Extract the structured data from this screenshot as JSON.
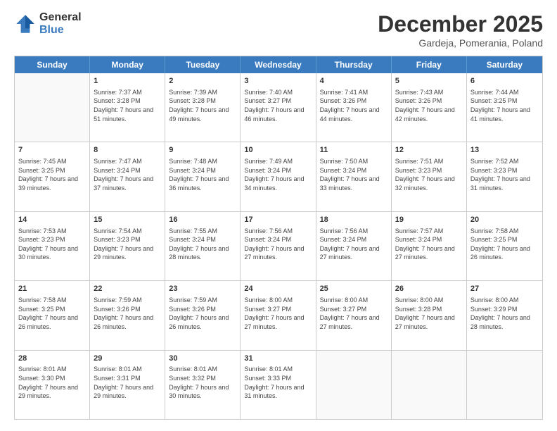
{
  "logo": {
    "general": "General",
    "blue": "Blue"
  },
  "title": "December 2025",
  "subtitle": "Gardeja, Pomerania, Poland",
  "days": [
    "Sunday",
    "Monday",
    "Tuesday",
    "Wednesday",
    "Thursday",
    "Friday",
    "Saturday"
  ],
  "weeks": [
    [
      {
        "num": "",
        "sunrise": "",
        "sunset": "",
        "daylight": ""
      },
      {
        "num": "1",
        "sunrise": "Sunrise: 7:37 AM",
        "sunset": "Sunset: 3:28 PM",
        "daylight": "Daylight: 7 hours and 51 minutes."
      },
      {
        "num": "2",
        "sunrise": "Sunrise: 7:39 AM",
        "sunset": "Sunset: 3:28 PM",
        "daylight": "Daylight: 7 hours and 49 minutes."
      },
      {
        "num": "3",
        "sunrise": "Sunrise: 7:40 AM",
        "sunset": "Sunset: 3:27 PM",
        "daylight": "Daylight: 7 hours and 46 minutes."
      },
      {
        "num": "4",
        "sunrise": "Sunrise: 7:41 AM",
        "sunset": "Sunset: 3:26 PM",
        "daylight": "Daylight: 7 hours and 44 minutes."
      },
      {
        "num": "5",
        "sunrise": "Sunrise: 7:43 AM",
        "sunset": "Sunset: 3:26 PM",
        "daylight": "Daylight: 7 hours and 42 minutes."
      },
      {
        "num": "6",
        "sunrise": "Sunrise: 7:44 AM",
        "sunset": "Sunset: 3:25 PM",
        "daylight": "Daylight: 7 hours and 41 minutes."
      }
    ],
    [
      {
        "num": "7",
        "sunrise": "Sunrise: 7:45 AM",
        "sunset": "Sunset: 3:25 PM",
        "daylight": "Daylight: 7 hours and 39 minutes."
      },
      {
        "num": "8",
        "sunrise": "Sunrise: 7:47 AM",
        "sunset": "Sunset: 3:24 PM",
        "daylight": "Daylight: 7 hours and 37 minutes."
      },
      {
        "num": "9",
        "sunrise": "Sunrise: 7:48 AM",
        "sunset": "Sunset: 3:24 PM",
        "daylight": "Daylight: 7 hours and 36 minutes."
      },
      {
        "num": "10",
        "sunrise": "Sunrise: 7:49 AM",
        "sunset": "Sunset: 3:24 PM",
        "daylight": "Daylight: 7 hours and 34 minutes."
      },
      {
        "num": "11",
        "sunrise": "Sunrise: 7:50 AM",
        "sunset": "Sunset: 3:24 PM",
        "daylight": "Daylight: 7 hours and 33 minutes."
      },
      {
        "num": "12",
        "sunrise": "Sunrise: 7:51 AM",
        "sunset": "Sunset: 3:23 PM",
        "daylight": "Daylight: 7 hours and 32 minutes."
      },
      {
        "num": "13",
        "sunrise": "Sunrise: 7:52 AM",
        "sunset": "Sunset: 3:23 PM",
        "daylight": "Daylight: 7 hours and 31 minutes."
      }
    ],
    [
      {
        "num": "14",
        "sunrise": "Sunrise: 7:53 AM",
        "sunset": "Sunset: 3:23 PM",
        "daylight": "Daylight: 7 hours and 30 minutes."
      },
      {
        "num": "15",
        "sunrise": "Sunrise: 7:54 AM",
        "sunset": "Sunset: 3:23 PM",
        "daylight": "Daylight: 7 hours and 29 minutes."
      },
      {
        "num": "16",
        "sunrise": "Sunrise: 7:55 AM",
        "sunset": "Sunset: 3:24 PM",
        "daylight": "Daylight: 7 hours and 28 minutes."
      },
      {
        "num": "17",
        "sunrise": "Sunrise: 7:56 AM",
        "sunset": "Sunset: 3:24 PM",
        "daylight": "Daylight: 7 hours and 27 minutes."
      },
      {
        "num": "18",
        "sunrise": "Sunrise: 7:56 AM",
        "sunset": "Sunset: 3:24 PM",
        "daylight": "Daylight: 7 hours and 27 minutes."
      },
      {
        "num": "19",
        "sunrise": "Sunrise: 7:57 AM",
        "sunset": "Sunset: 3:24 PM",
        "daylight": "Daylight: 7 hours and 27 minutes."
      },
      {
        "num": "20",
        "sunrise": "Sunrise: 7:58 AM",
        "sunset": "Sunset: 3:25 PM",
        "daylight": "Daylight: 7 hours and 26 minutes."
      }
    ],
    [
      {
        "num": "21",
        "sunrise": "Sunrise: 7:58 AM",
        "sunset": "Sunset: 3:25 PM",
        "daylight": "Daylight: 7 hours and 26 minutes."
      },
      {
        "num": "22",
        "sunrise": "Sunrise: 7:59 AM",
        "sunset": "Sunset: 3:26 PM",
        "daylight": "Daylight: 7 hours and 26 minutes."
      },
      {
        "num": "23",
        "sunrise": "Sunrise: 7:59 AM",
        "sunset": "Sunset: 3:26 PM",
        "daylight": "Daylight: 7 hours and 26 minutes."
      },
      {
        "num": "24",
        "sunrise": "Sunrise: 8:00 AM",
        "sunset": "Sunset: 3:27 PM",
        "daylight": "Daylight: 7 hours and 27 minutes."
      },
      {
        "num": "25",
        "sunrise": "Sunrise: 8:00 AM",
        "sunset": "Sunset: 3:27 PM",
        "daylight": "Daylight: 7 hours and 27 minutes."
      },
      {
        "num": "26",
        "sunrise": "Sunrise: 8:00 AM",
        "sunset": "Sunset: 3:28 PM",
        "daylight": "Daylight: 7 hours and 27 minutes."
      },
      {
        "num": "27",
        "sunrise": "Sunrise: 8:00 AM",
        "sunset": "Sunset: 3:29 PM",
        "daylight": "Daylight: 7 hours and 28 minutes."
      }
    ],
    [
      {
        "num": "28",
        "sunrise": "Sunrise: 8:01 AM",
        "sunset": "Sunset: 3:30 PM",
        "daylight": "Daylight: 7 hours and 29 minutes."
      },
      {
        "num": "29",
        "sunrise": "Sunrise: 8:01 AM",
        "sunset": "Sunset: 3:31 PM",
        "daylight": "Daylight: 7 hours and 29 minutes."
      },
      {
        "num": "30",
        "sunrise": "Sunrise: 8:01 AM",
        "sunset": "Sunset: 3:32 PM",
        "daylight": "Daylight: 7 hours and 30 minutes."
      },
      {
        "num": "31",
        "sunrise": "Sunrise: 8:01 AM",
        "sunset": "Sunset: 3:33 PM",
        "daylight": "Daylight: 7 hours and 31 minutes."
      },
      {
        "num": "",
        "sunrise": "",
        "sunset": "",
        "daylight": ""
      },
      {
        "num": "",
        "sunrise": "",
        "sunset": "",
        "daylight": ""
      },
      {
        "num": "",
        "sunrise": "",
        "sunset": "",
        "daylight": ""
      }
    ]
  ]
}
